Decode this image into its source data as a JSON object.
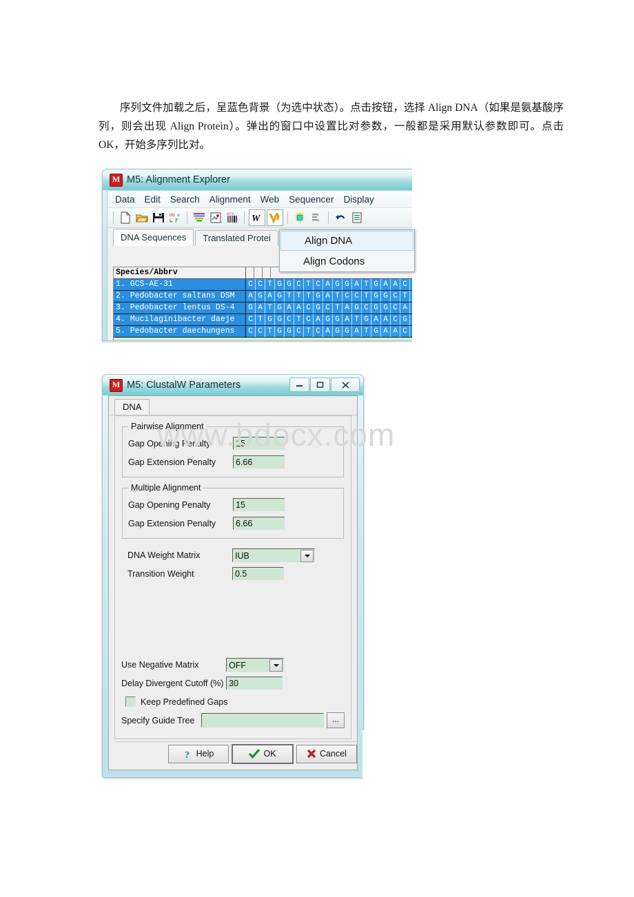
{
  "document": {
    "paragraph_lines": [
      "序列文件加载之后，呈蓝色背景（为选中状态）。点击按钮，选择 Align DNA（如果是氨基酸序列，则会出现 Align Protein）。弹出的窗口中设置比对参数，一般都是采用默认参数即可。点击 OK，开始多序列比对。"
    ]
  },
  "watermark": {
    "text": "www.bdocx.com"
  },
  "alignment_explorer": {
    "title": "M5: Alignment Explorer",
    "app_icon": "M",
    "menu": [
      "Data",
      "Edit",
      "Search",
      "Alignment",
      "Web",
      "Sequencer",
      "Display"
    ],
    "toolbar_icons": [
      "new-file-icon",
      "open-folder-icon",
      "save-disk-icon",
      "translate-icon",
      "separator",
      "sequence-bars-icon",
      "export-image-icon",
      "atcg-bars-icon",
      "separator",
      "clustalw-w-icon",
      "muscle-v-icon",
      "separator",
      "highlight-icon",
      "add-sequence-icon",
      "separator",
      "undo-icon",
      "list-icon"
    ],
    "tabs": [
      {
        "label": "DNA Sequences",
        "active": true
      },
      {
        "label": "Translated Protei",
        "active": false
      }
    ],
    "grid": {
      "name_header": "Species/Abbrv",
      "rows": [
        {
          "name": "1. GCS-AE-31",
          "bases": "CCTGGCTCAGGATGAACGCTAGC"
        },
        {
          "name": "2. Pedobacter saltans DSM",
          "bases": "AGAGTTTGATCCTGGCTCAGGAT"
        },
        {
          "name": "3. Pedobacter lentus DS-4",
          "bases": "GATGAACGCTAGCGGCAGGCCTA"
        },
        {
          "name": "4. Mucilaginibacter daeje",
          "bases": "CTGGCTCAGGATGAACGCTAGCG"
        },
        {
          "name": "5. Pedobacter daechungens",
          "bases": "CCTGGCTCAGGATGAACGCTAGC"
        }
      ]
    },
    "dropdown_menu": {
      "items": [
        {
          "label": "Align DNA",
          "highlighted": true
        },
        {
          "label": "Align Codons",
          "highlighted": false
        }
      ]
    },
    "window_buttons": []
  },
  "clustalw_dialog": {
    "title": "M5: ClustalW Parameters",
    "app_icon": "M",
    "window_buttons": [
      "minimize",
      "maximize",
      "close"
    ],
    "tabs": [
      {
        "label": "DNA",
        "active": true
      }
    ],
    "groups": [
      {
        "legend": "Pairwise Alignment",
        "fields": [
          {
            "label": "Gap Opening Penalty",
            "value": "15"
          },
          {
            "label": "Gap Extension Penalty",
            "value": "6.66"
          }
        ]
      },
      {
        "legend": "Multiple Alignment",
        "fields": [
          {
            "label": "Gap Opening Penalty",
            "value": "15"
          },
          {
            "label": "Gap Extension Penalty",
            "value": "6.66"
          }
        ]
      }
    ],
    "matrix_fields": [
      {
        "label": "DNA Weight Matrix",
        "value": "IUB",
        "type": "select"
      },
      {
        "label": "Transition Weight",
        "value": "0.5",
        "type": "text"
      }
    ],
    "bottom_fields": {
      "use_negative_matrix": {
        "label": "Use Negative Matrix",
        "value": "OFF"
      },
      "delay_divergent": {
        "label": "Delay Divergent Cutoff (%)",
        "value": "30"
      },
      "keep_predefined_gaps": {
        "label": "Keep Predefined Gaps",
        "checked": false
      },
      "specify_guide_tree": {
        "label": "Specify Guide Tree",
        "value": "",
        "browse_label": "..."
      }
    },
    "buttons": [
      {
        "label": "Help",
        "icon": "question-icon",
        "accel": "H"
      },
      {
        "label": "OK",
        "icon": "check-icon",
        "default": true
      },
      {
        "label": "Cancel",
        "icon": "x-icon"
      }
    ]
  },
  "colors": {
    "aero_title": "#9fd9df",
    "selection_blue": "#2f97e8",
    "field_green": "#cfe8d3",
    "dialog_gray": "#eeeeee",
    "watermark_gray": "#d8d8d8",
    "ok_green": "#1c8a1c",
    "cancel_red": "#b71c1c"
  }
}
